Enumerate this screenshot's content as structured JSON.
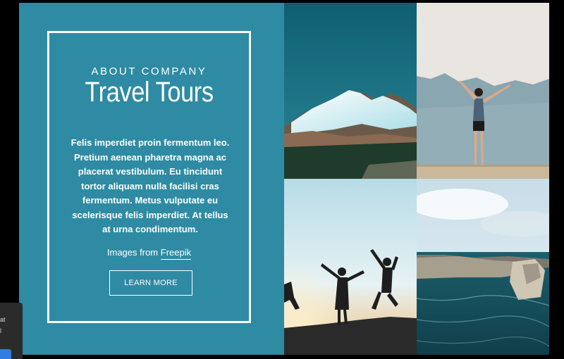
{
  "about": {
    "eyebrow": "ABOUT COMPANY",
    "title": "Travel Tours",
    "body_lines": [
      "Felis imperdiet proin fermentum leo.",
      "Pretium aenean pharetra magna ac",
      "placerat vestibulum. Eu tincidunt",
      "tortor aliquam nulla facilisi cras",
      "fermentum. Metus vulputate eu",
      "scelerisque felis imperdiet. At tellus",
      "at urna condimentum."
    ],
    "credit_prefix": "Images from ",
    "credit_link": "Freepik",
    "button_label": "LEARN MORE"
  },
  "colors": {
    "panel": "#2e8ba3",
    "page_background": "#000000",
    "toast_button": "#2f7de1"
  },
  "gallery": {
    "photos": [
      "snowy-mountain-photo",
      "woman-arms-raised-photo",
      "friends-jumping-sunset-photo",
      "sea-cliffs-photo"
    ]
  },
  "toast": {
    "lines": [
      "at",
      "l"
    ]
  }
}
